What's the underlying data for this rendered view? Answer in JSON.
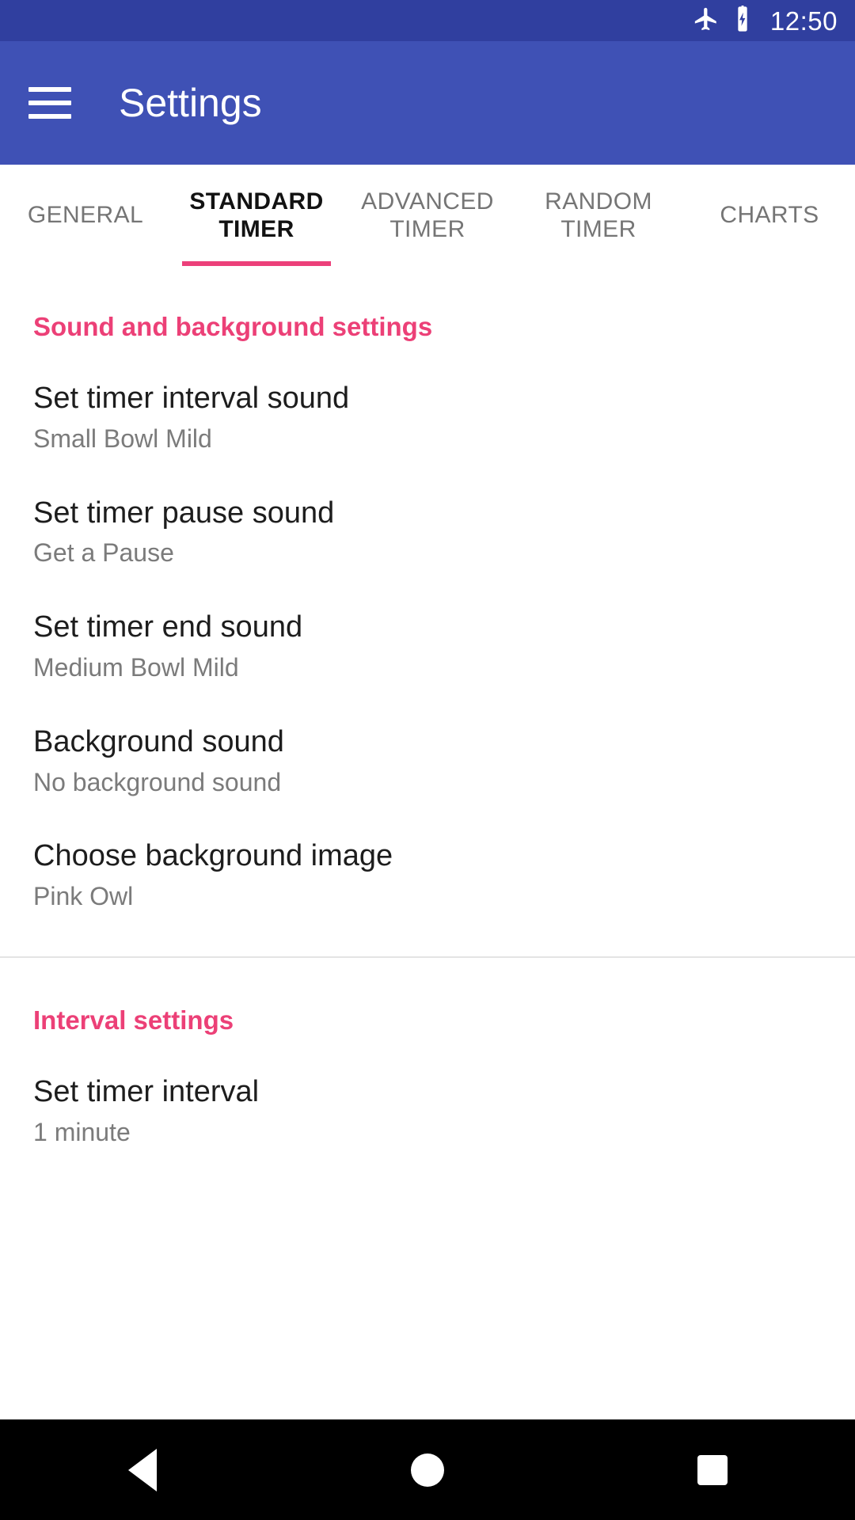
{
  "status_bar": {
    "airplane_icon": "airplane-mode-icon",
    "battery_icon": "battery-charging-icon",
    "time": "12:50",
    "background_color": "#303F9F"
  },
  "app_bar": {
    "menu_icon": "hamburger-menu-icon",
    "title": "Settings",
    "background_color": "#3F51B5"
  },
  "tabs": {
    "active_index": 1,
    "indicator_color": "#EC407A",
    "items": [
      {
        "label": "GENERAL"
      },
      {
        "label": "STANDARD TIMER"
      },
      {
        "label": "ADVANCED TIMER"
      },
      {
        "label": "RANDOM TIMER"
      },
      {
        "label": "CHARTS"
      }
    ]
  },
  "sections": [
    {
      "header": "Sound and background settings",
      "header_color": "#EC4077",
      "items": [
        {
          "title": "Set timer interval sound",
          "summary": "Small Bowl Mild"
        },
        {
          "title": "Set timer pause sound",
          "summary": "Get a Pause"
        },
        {
          "title": "Set timer end sound",
          "summary": "Medium Bowl Mild"
        },
        {
          "title": "Background sound",
          "summary": "No background sound"
        },
        {
          "title": "Choose background image",
          "summary": "Pink Owl"
        }
      ]
    },
    {
      "header": "Interval settings",
      "header_color": "#EC4077",
      "items": [
        {
          "title": "Set timer interval",
          "summary": "1 minute"
        }
      ]
    }
  ],
  "nav_bar": {
    "back_icon": "back-triangle-icon",
    "home_icon": "home-circle-icon",
    "recents_icon": "recents-square-icon",
    "background_color": "#000000"
  }
}
